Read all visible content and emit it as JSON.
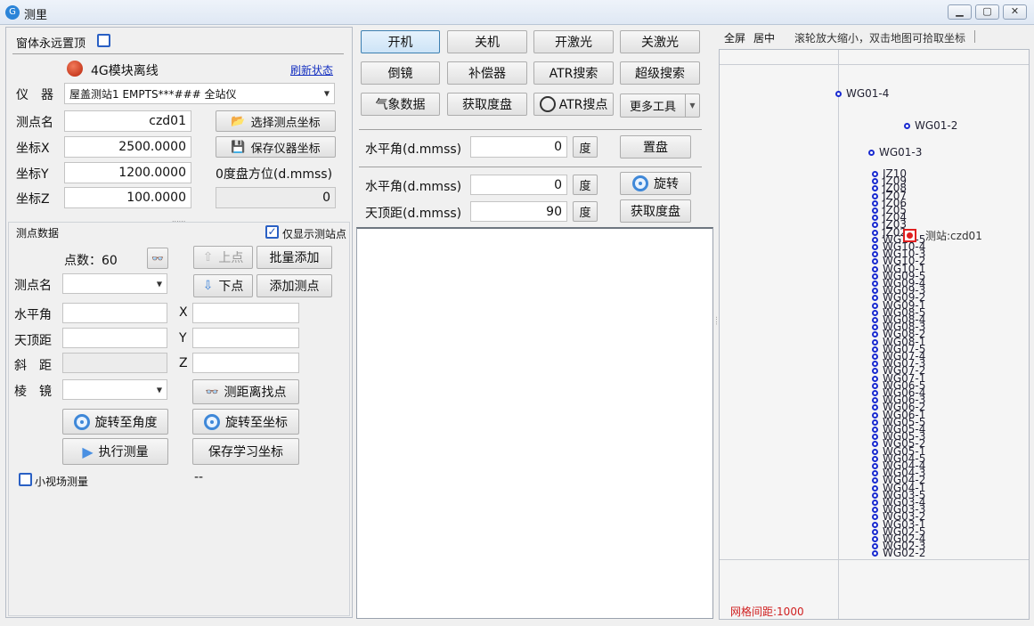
{
  "window": {
    "title": "测里",
    "min": "▁",
    "max": "▢",
    "close": "✕"
  },
  "left": {
    "topmost_label": "窗体永远置顶",
    "status_text": "4G模块离线",
    "refresh_link": "刷新状态",
    "instrument_label": "仪　器",
    "instrument_value": "屋盖测站1 EMPTS***### 全站仪",
    "station_label": "测点名",
    "station_value": "czd01",
    "select_coord_btn": "选择测点坐标",
    "x_label": "坐标X",
    "x_value": "2500.0000",
    "save_coord_btn": "保存仪器坐标",
    "y_label": "坐标Y",
    "y_value": "1200.0000",
    "zero_label": "0度盘方位(d.mmss)",
    "z_label": "坐标Z",
    "z_value": "100.0000",
    "zero_value": "0",
    "points_section": "测点数据",
    "only_station_label": "仅显示测站点",
    "count_label": "点数：60",
    "prev_btn": "上点",
    "next_btn": "下点",
    "batch_add_btn": "批量添加",
    "add_point_btn": "添加测点",
    "point_name_label": "测点名",
    "hz_label": "水平角",
    "x2_label": "X",
    "v_label": "天顶距",
    "y2_label": "Y",
    "slope_label": "斜　距",
    "z2_label": "Z",
    "prism_label": "棱　镜",
    "find_point_btn": "测距离找点",
    "rotate_angle_btn": "旋转至角度",
    "rotate_coord_btn": "旋转至坐标",
    "measure_btn": "执行测量",
    "save_learn_btn": "保存学习坐标",
    "small_view_label": "小视场测量",
    "dash": "--"
  },
  "middle": {
    "buttons": [
      "开机",
      "关机",
      "开激光",
      "关激光",
      "倒镜",
      "补偿器",
      "ATR搜索",
      "超级搜索",
      "气象数据",
      "获取度盘",
      "ATR搜点",
      "更多工具"
    ],
    "hz1_label": "水平角(d.mmss)",
    "hz1_value": "0",
    "deg1": "度",
    "set_btn": "置盘",
    "hz2_label": "水平角(d.mmss)",
    "hz2_value": "0",
    "deg2": "度",
    "rotate_btn": "旋转",
    "v_label": "天顶距(d.mmss)",
    "v_value": "90",
    "deg3": "度",
    "get_btn": "获取度盘"
  },
  "map": {
    "full_label": "全屏",
    "center_label": "居中",
    "hint": "滚轮放大缩小，双击地图可拾取坐标",
    "grid_label": "网格间距:1000",
    "station_label": "测站:czd01",
    "points": [
      "WG01-4",
      "WG01-2",
      "WG01-3",
      "JZ10",
      "JZ09",
      "JZ08",
      "JZ07",
      "JZ06",
      "JZ05",
      "JZ04",
      "JZ03",
      "JZ02",
      "WG10-5",
      "WG10-4",
      "WG10-3",
      "WG10-2",
      "WG10-1",
      "WG09-5",
      "WG09-4",
      "WG09-3",
      "WG09-2",
      "WG09-1",
      "WG08-5",
      "WG08-4",
      "WG08-3",
      "WG08-2",
      "WG08-1",
      "WG07-5",
      "WG07-4",
      "WG07-3",
      "WG07-2",
      "WG07-1",
      "WG06-5",
      "WG06-4",
      "WG06-3",
      "WG06-2",
      "WG06-1",
      "WG05-5",
      "WG05-4",
      "WG05-3",
      "WG05-2",
      "WG05-1",
      "WG04-5",
      "WG04-4",
      "WG04-3",
      "WG04-2",
      "WG04-1",
      "WG03-5",
      "WG03-4",
      "WG03-3",
      "WG03-2",
      "WG03-1",
      "WG02-5",
      "WG02-4",
      "WG02-3",
      "WG02-2"
    ],
    "colors": {
      "points": "#1a2bd0",
      "station": "#e02020",
      "grid_text": "#d02020"
    }
  }
}
